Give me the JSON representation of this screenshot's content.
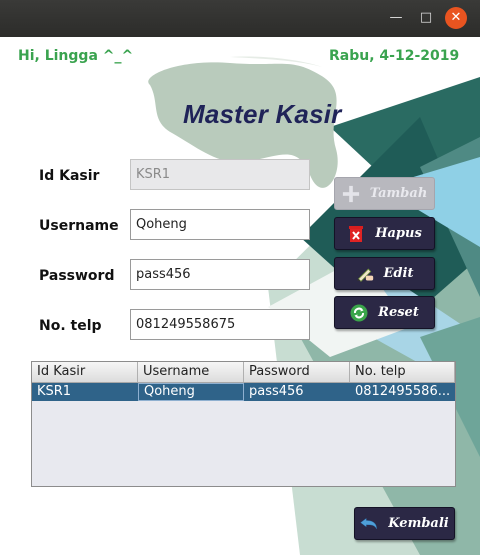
{
  "window": {
    "minimize_glyph": "—",
    "maximize_glyph": "□",
    "close_glyph": "✕"
  },
  "header": {
    "greeting": "Hi, Lingga ^_^",
    "date": "Rabu, 4-12-2019"
  },
  "title": "Master Kasir",
  "form": {
    "id_kasir": {
      "label": "Id Kasir",
      "value": "KSR1"
    },
    "username": {
      "label": "Username",
      "value": "Qoheng"
    },
    "password": {
      "label": "Password",
      "value": "pass456"
    },
    "no_telp": {
      "label": "No. telp",
      "value": "081249558675"
    }
  },
  "buttons": {
    "tambah": "Tambah",
    "hapus": "Hapus",
    "edit": "Edit",
    "reset": "Reset",
    "kembali": "Kembali"
  },
  "table": {
    "columns": [
      "Id Kasir",
      "Username",
      "Password",
      "No. telp"
    ],
    "rows": [
      [
        "KSR1",
        "Qoheng",
        "pass456",
        "0812495586..."
      ]
    ]
  },
  "colors": {
    "accent_green": "#3aa34f",
    "title_navy": "#1f2358",
    "button_dark": "#2b2845",
    "selection": "#2f6389"
  }
}
